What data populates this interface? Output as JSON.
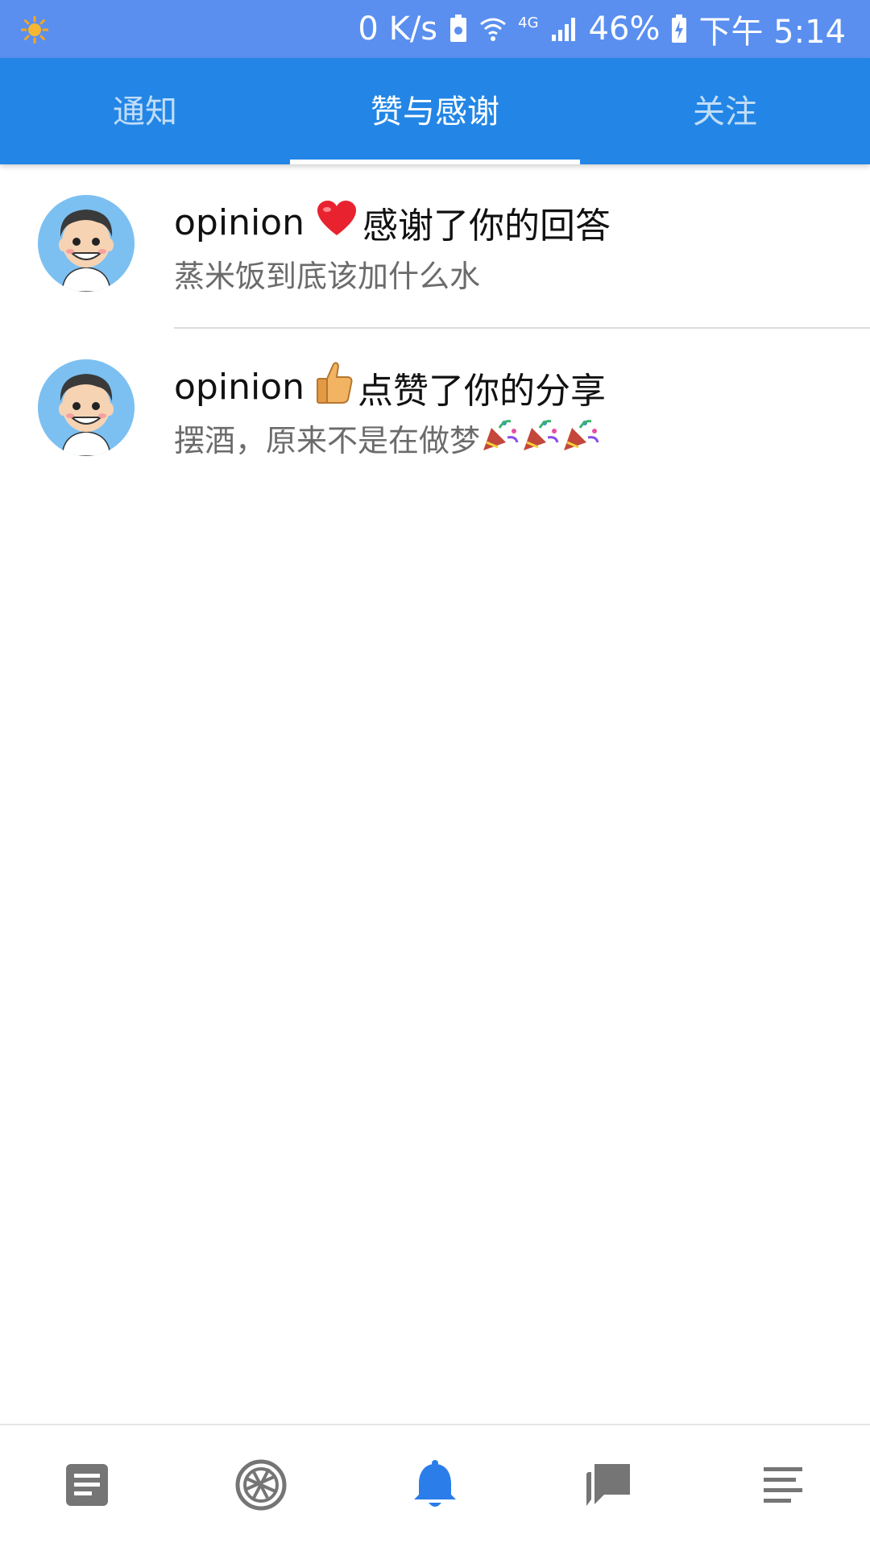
{
  "status_bar": {
    "network_speed": "0 K/s",
    "network_type": "4G",
    "battery": "46%",
    "time": "下午 5:14",
    "icons": [
      "weather-sun-icon",
      "storage-icon",
      "wifi-icon",
      "signal-icon",
      "battery-charging-icon"
    ]
  },
  "tabs": [
    {
      "label": "通知",
      "active": false
    },
    {
      "label": "赞与感谢",
      "active": true
    },
    {
      "label": "关注",
      "active": false
    }
  ],
  "notifications": [
    {
      "user": "opinion",
      "emoji_icon": "heart-icon",
      "action": "感谢了你的回答",
      "subtitle": "蒸米饭到底该加什么水"
    },
    {
      "user": "opinion",
      "emoji_icon": "thumbs-up-icon",
      "action": "点赞了你的分享",
      "subtitle": "摆酒，原来不是在做梦",
      "subtitle_icons": [
        "party-popper-icon",
        "party-popper-icon",
        "party-popper-icon"
      ]
    }
  ],
  "bottom_nav": [
    {
      "icon": "article-icon",
      "active": false
    },
    {
      "icon": "camera-shutter-icon",
      "active": false
    },
    {
      "icon": "bell-icon",
      "active": true
    },
    {
      "icon": "chat-icon",
      "active": false
    },
    {
      "icon": "menu-lines-icon",
      "active": false
    }
  ],
  "colors": {
    "status_bar": "#5a8ff0",
    "tab_bar": "#2386e6",
    "nav_active": "#2b7de9",
    "nav_inactive": "#757575"
  }
}
